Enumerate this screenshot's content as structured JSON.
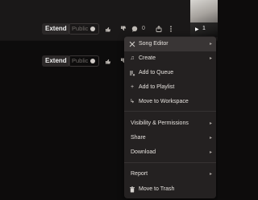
{
  "rows": [
    {
      "extend_label": "Extend",
      "public_label": "Public",
      "comments_count": "0"
    },
    {
      "extend_label": "Extend",
      "public_label": "Public"
    }
  ],
  "thumbnail": {
    "play_icon": "play-icon",
    "play_count": "1"
  },
  "menu": {
    "items": [
      {
        "label": "Song Editor",
        "icon": "scissors-icon",
        "has_submenu": true
      },
      {
        "label": "Create",
        "icon": "music-note-icon",
        "has_submenu": true
      },
      {
        "label": "Add to Queue",
        "icon": "queue-icon",
        "has_submenu": false
      },
      {
        "label": "Add to Playlist",
        "icon": "plus-icon",
        "has_submenu": false
      },
      {
        "label": "Move to Workspace",
        "icon": "move-arrow-icon",
        "has_submenu": false
      },
      {
        "label": "Visibility & Permissions",
        "has_submenu": true
      },
      {
        "label": "Share",
        "has_submenu": true
      },
      {
        "label": "Download",
        "has_submenu": true
      },
      {
        "label": "Report",
        "has_submenu": true
      },
      {
        "label": "Move to Trash",
        "icon": "trash-icon",
        "has_submenu": false
      }
    ]
  },
  "colors": {
    "background": "#0d0c0c",
    "menu_bg": "#242121",
    "highlight": "#393535",
    "text": "#e6e2de"
  }
}
